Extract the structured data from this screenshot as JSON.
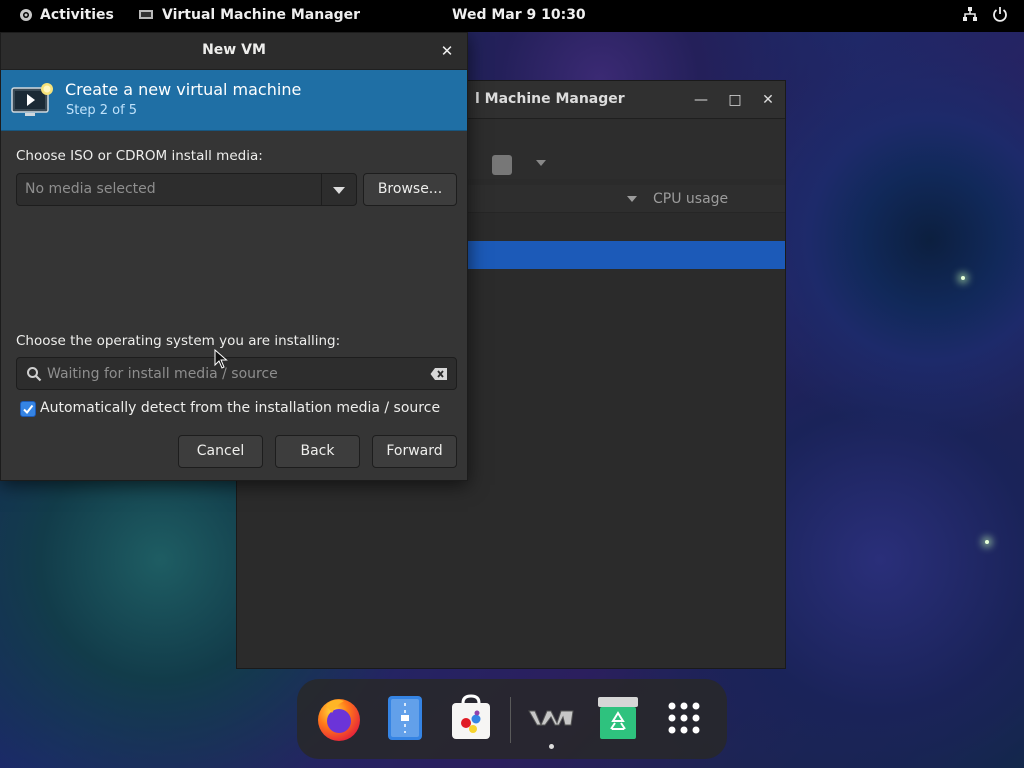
{
  "topbar": {
    "activities": "Activities",
    "app_name": "Virtual Machine Manager",
    "clock": "Wed Mar 9  10:30"
  },
  "background_window": {
    "title": "l Machine Manager",
    "column_header": "CPU usage"
  },
  "dialog": {
    "title": "New VM",
    "banner_heading": "Create a new virtual machine",
    "banner_step": "Step 2 of 5",
    "media_label": "Choose ISO or CDROM install media:",
    "media_value": "No media selected",
    "browse_label": "Browse...",
    "os_label": "Choose the operating system you are installing:",
    "os_placeholder": "Waiting for install media / source",
    "autodetect_label": "Automatically detect from the installation media / source",
    "autodetect_checked": true,
    "cancel_label": "Cancel",
    "back_label": "Back",
    "forward_label": "Forward"
  },
  "dock": {
    "items": [
      "firefox-icon",
      "text-editor-icon",
      "software-store-icon",
      "virt-manager-icon",
      "recycle-bin-icon",
      "app-grid-icon"
    ]
  },
  "colors": {
    "banner": "#1f6fa5",
    "accent": "#3584e4",
    "selection": "#1c5ab8"
  }
}
